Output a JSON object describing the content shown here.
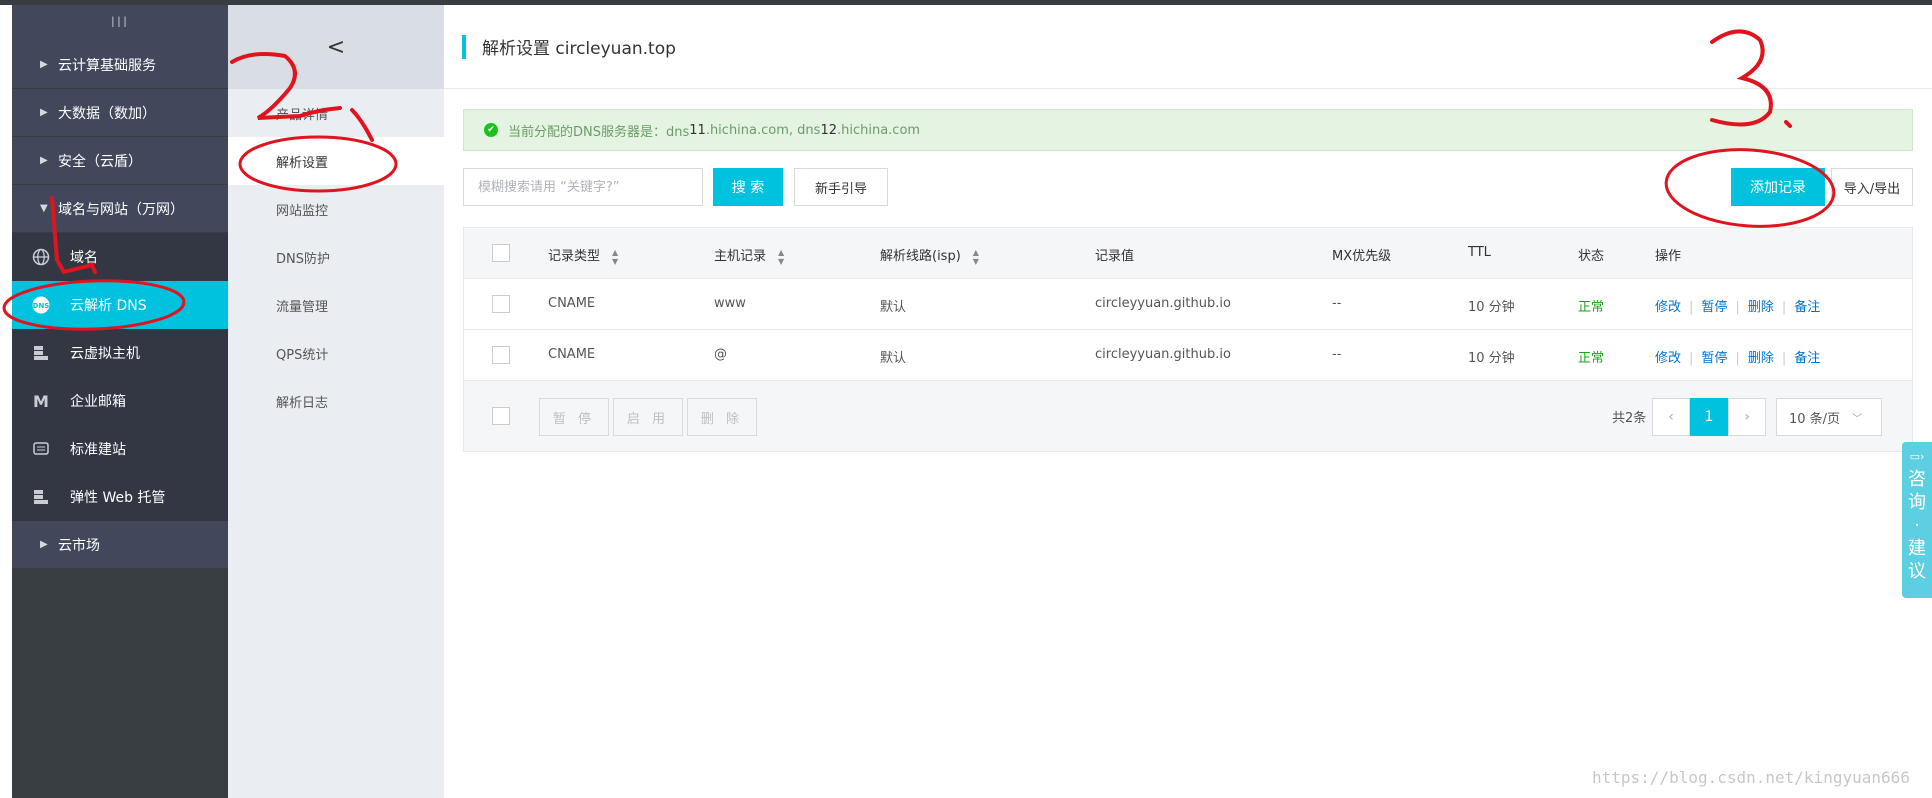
{
  "sidebar": {
    "toggle": "III",
    "groups_top": [
      {
        "label": "云计算基础服务"
      },
      {
        "label": "大数据（数加）"
      },
      {
        "label": "安全（云盾）"
      }
    ],
    "group_open": {
      "label": "域名与网站（万网）"
    },
    "items": [
      {
        "label": "域名",
        "icon": "globe-icon"
      },
      {
        "label": "云解析 DNS",
        "icon": "dns-icon"
      },
      {
        "label": "云虚拟主机",
        "icon": "server-icon"
      },
      {
        "label": "企业邮箱",
        "icon": "mail-m-icon"
      },
      {
        "label": "标准建站",
        "icon": "monitor-icon"
      },
      {
        "label": "弹性 Web 托管",
        "icon": "server-icon"
      }
    ],
    "group_bottom": {
      "label": "云市场"
    }
  },
  "subnav": {
    "back": "<",
    "items": [
      "产品详情",
      "解析设置",
      "网站监控",
      "DNS防护",
      "流量管理",
      "QPS统计",
      "解析日志"
    ]
  },
  "page": {
    "title": "解析设置 circleyuan.top"
  },
  "alert": {
    "prefix": "当前分配的DNS服务器是：dns",
    "n1": "11",
    "mid": ".hichina.com, dns",
    "n2": "12",
    "suffix": ".hichina.com"
  },
  "toolbar": {
    "search_placeholder": "模糊搜索请用 “关键字?”",
    "search_btn": "搜 索",
    "guide_btn": "新手引导",
    "add_btn": "添加记录",
    "import_btn": "导入/导出"
  },
  "table": {
    "columns": [
      "记录类型",
      "主机记录",
      "解析线路(isp)",
      "记录值",
      "MX优先级",
      "TTL",
      "状态",
      "操作"
    ],
    "rows": [
      {
        "type": "CNAME",
        "host": "www",
        "line": "默认",
        "value": "circleyyuan.github.io",
        "mx": "--",
        "ttl": "10 分钟",
        "status": "正常"
      },
      {
        "type": "CNAME",
        "host": "@",
        "line": "默认",
        "value": "circleyyuan.github.io",
        "mx": "--",
        "ttl": "10 分钟",
        "status": "正常"
      }
    ],
    "actions": [
      "修改",
      "暂停",
      "删除",
      "备注"
    ],
    "bulk": [
      "暂 停",
      "启 用",
      "删 除"
    ],
    "total": "共2条",
    "current_page": "1",
    "page_size": "10 条/页"
  },
  "consult": {
    "chars": [
      "咨",
      "询",
      "·",
      "建",
      "议"
    ]
  },
  "watermark": "https://blog.csdn.net/kingyuan666",
  "annotations": [
    "1",
    "2",
    "3"
  ],
  "colors": {
    "accent": "#00c1de",
    "sidebar": "#373d41",
    "link": "#0073ce",
    "ok": "#1ea31e",
    "annotation": "#e0141e"
  }
}
